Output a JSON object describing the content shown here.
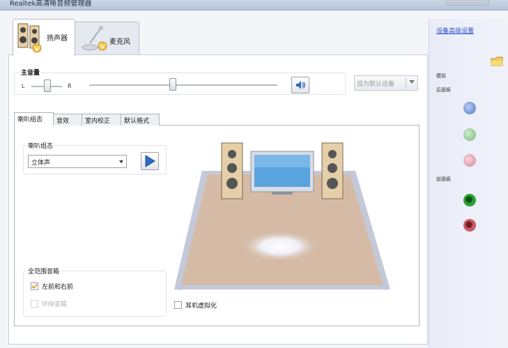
{
  "window": {
    "title": "Realtek高清晰音频管理器"
  },
  "device_tabs": [
    {
      "label": "扬声器",
      "active": true
    },
    {
      "label": "麦克风",
      "active": false
    }
  ],
  "master_volume": {
    "label": "主音量",
    "balance_left": "L",
    "balance_right": "R",
    "balance_level": 0.5,
    "volume_level": 0.44
  },
  "default_device": {
    "label": "设为默认设备"
  },
  "inner_tabs": [
    {
      "label": "喇叭组态",
      "active": true
    },
    {
      "label": "音效",
      "active": false
    },
    {
      "label": "室内校正",
      "active": false
    },
    {
      "label": "默认格式",
      "active": false
    }
  ],
  "speaker_config": {
    "group_label": "喇叭组态",
    "selected": "立体声"
  },
  "full_range": {
    "group_label": "全范围音箱",
    "front_lr": {
      "label": "左前和右前",
      "checked": true,
      "enabled": true
    },
    "surround": {
      "label": "环绕音箱",
      "checked": false,
      "enabled": false
    }
  },
  "headphone_virtualization": {
    "label": "耳机虚拟化",
    "checked": false
  },
  "right_panel": {
    "link": "设备高级设置",
    "analog_label": "模拟",
    "back_panel_label": "后面板",
    "front_panel_label": "前面板",
    "back_jacks": [
      {
        "name": "blue-jack",
        "color": "#7d9ed8"
      },
      {
        "name": "green-jack",
        "color": "#9ccf9c"
      },
      {
        "name": "pink-jack",
        "color": "#e6a9b8"
      }
    ],
    "front_jacks": [
      {
        "name": "green-jack",
        "color": "#2faa3a"
      },
      {
        "name": "pink-jack",
        "color": "#d8606f"
      }
    ]
  },
  "colors": {
    "floor": "#d5bba6",
    "link": "#2b4fc7",
    "accent_blue": "#2b6dc4"
  }
}
